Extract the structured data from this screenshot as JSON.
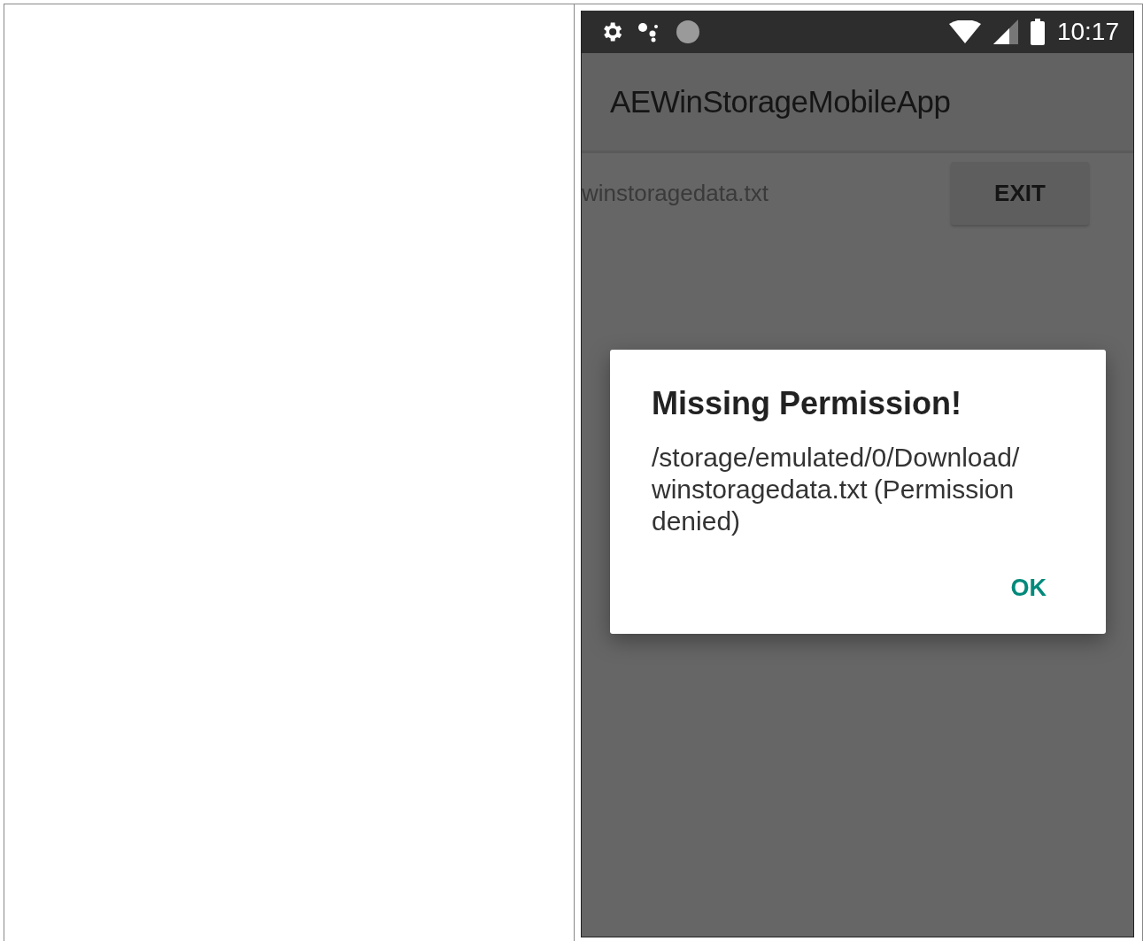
{
  "status_bar": {
    "time": "10:17"
  },
  "app_bar": {
    "title": "AEWinStorageMobileApp"
  },
  "content": {
    "file_label": "winstoragedata.txt",
    "exit_button": "EXIT"
  },
  "dialog": {
    "title": "Missing Permission!",
    "message": "/storage/emulated/0/Download/ winstoragedata.txt (Permission denied)",
    "buttons": [
      "OK"
    ]
  }
}
